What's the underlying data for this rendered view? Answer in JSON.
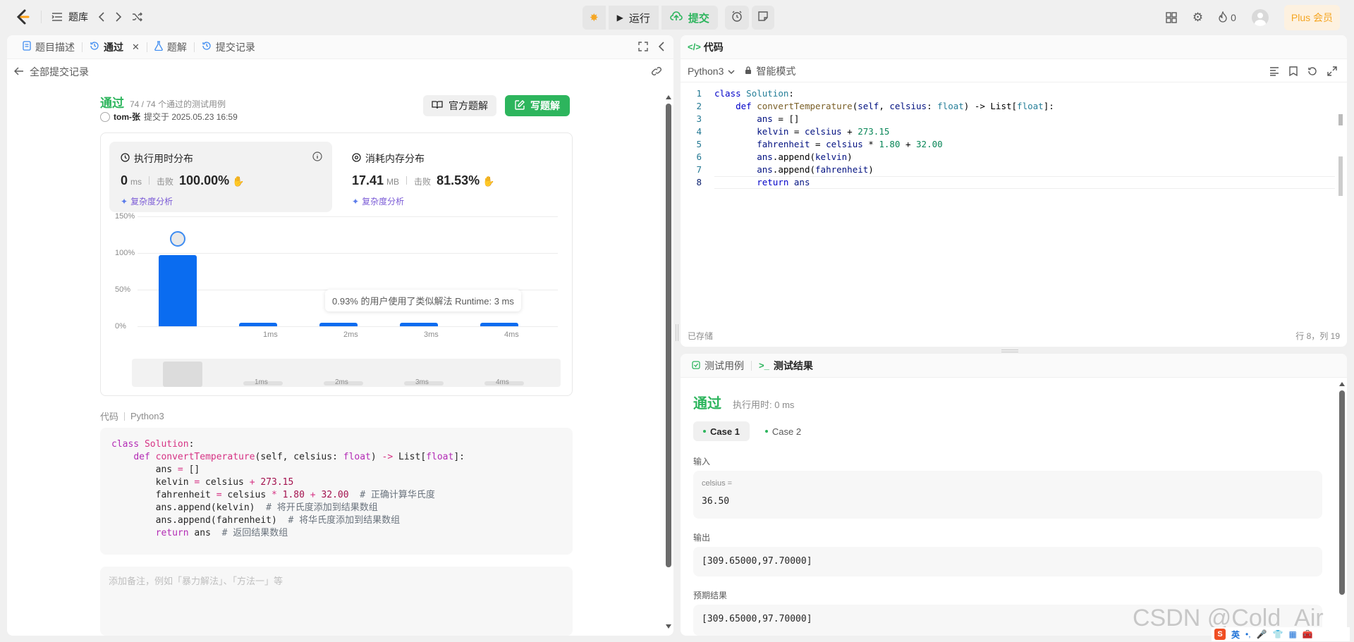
{
  "topbar": {
    "problem_bank_label": "题库",
    "run_label": "运行",
    "submit_label": "提交",
    "streak_count": "0",
    "plus_label": "Plus 会员"
  },
  "left_panel": {
    "tabs": [
      {
        "label": "题目描述"
      },
      {
        "label": "通过"
      },
      {
        "label": "题解"
      },
      {
        "label": "提交记录"
      }
    ],
    "back_label": "全部提交记录",
    "status": "通过",
    "testcases_passed": "74 / 74 个通过的测试用例",
    "user": "tom-张",
    "submitted_at": "提交于 2025.05.23 16:59",
    "official_solution_label": "官方题解",
    "write_solution_label": "写题解",
    "runtime": {
      "title": "执行用时分布",
      "value": "0",
      "unit": "ms",
      "beats_label": "击败",
      "beats": "100.00%",
      "analysis_label": "复杂度分析"
    },
    "memory": {
      "title": "消耗内存分布",
      "value": "17.41",
      "unit": "MB",
      "beats_label": "击败",
      "beats": "81.53%",
      "analysis_label": "复杂度分析"
    },
    "tooltip": "0.93% 的用户使用了类似解法 Runtime: 3 ms",
    "code_label": "代码",
    "code_lang": "Python3",
    "code_lines": [
      "class Solution:",
      "    def convertTemperature(self, celsius: float) -> List[float]:",
      "        ans = []",
      "        kelvin = celsius + 273.15",
      "        fahrenheit = celsius * 1.80 + 32.00  # 正确计算华氏度",
      "        ans.append(kelvin)  # 将开氏度添加到结果数组",
      "        ans.append(fahrenheit)  # 将华氏度添加到结果数组",
      "        return ans  # 返回结果数组"
    ],
    "note_placeholder": "添加备注，例如「暴力解法」、「方法一」等"
  },
  "chart_data": {
    "type": "bar",
    "categories": [
      "",
      "1ms",
      "2ms",
      "3ms",
      "4ms"
    ],
    "values": [
      97,
      3,
      3,
      3,
      3
    ],
    "y_tick_labels": [
      "150%",
      "100%",
      "50%",
      "0%"
    ],
    "ylim": [
      0,
      150
    ],
    "grid": true,
    "highlight_index": 0,
    "bar_color": "#0a6cf0"
  },
  "code_panel": {
    "title": "代码",
    "lang": "Python3",
    "mode": "智能模式",
    "line_numbers": [
      "1",
      "2",
      "3",
      "4",
      "5",
      "6",
      "7",
      "8"
    ],
    "saved_label": "已存储",
    "cursor_pos": "行 8，列 19"
  },
  "test_panel": {
    "tab_cases": "测试用例",
    "tab_result": "测试结果",
    "status": "通过",
    "exec_time": "执行用时: 0 ms",
    "cases": [
      "Case 1",
      "Case 2"
    ],
    "input_label": "输入",
    "input_var": "celsius =",
    "input_value": "36.50",
    "output_label": "输出",
    "output_value": "[309.65000,97.70000]",
    "expected_label": "预期结果",
    "expected_value": "[309.65000,97.70000]"
  },
  "watermark": "CSDN @Cold_Air",
  "colors": {
    "accent_green": "#2db55d",
    "bar_blue": "#0a6cf0",
    "plus_orange": "#f5a623"
  }
}
